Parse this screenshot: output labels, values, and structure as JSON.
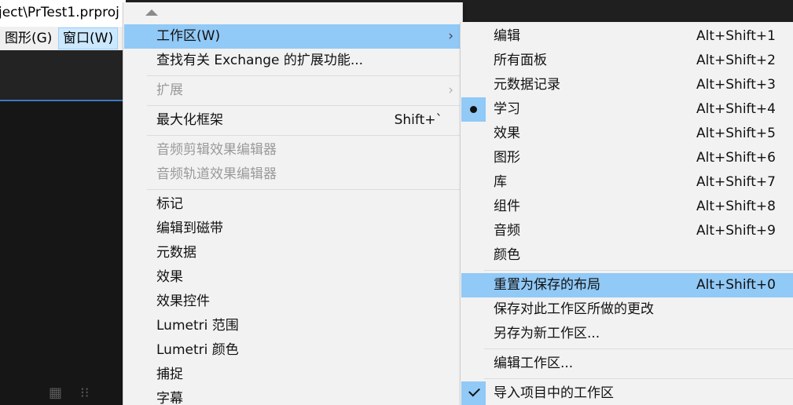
{
  "app": {
    "title_fragment": "ject\\PrTest1.prproj",
    "menubar": {
      "graphics": "图形(G)",
      "window": "窗口(W)"
    },
    "panel_icons": [
      "film-icon",
      "audio-waveform-icon"
    ]
  },
  "main_menu": {
    "scroll_up": "scroll-up-arrow-icon",
    "items": [
      {
        "label": "工作区(W)",
        "has_submenu": true,
        "state": "highlighted"
      },
      {
        "label": "查找有关 Exchange 的扩展功能..."
      },
      {
        "label": "扩展",
        "has_submenu": true,
        "state": "disabled"
      },
      {
        "label": "最大化框架",
        "shortcut": "Shift+`"
      },
      {
        "label": "音频剪辑效果编辑器",
        "state": "disabled"
      },
      {
        "label": "音频轨道效果编辑器",
        "state": "disabled"
      },
      {
        "label": "标记"
      },
      {
        "label": "编辑到磁带"
      },
      {
        "label": "元数据"
      },
      {
        "label": "效果"
      },
      {
        "label": "效果控件"
      },
      {
        "label": "Lumetri 范围"
      },
      {
        "label": "Lumetri 颜色"
      },
      {
        "label": "捕捉"
      },
      {
        "label": "字幕"
      }
    ]
  },
  "workspace_submenu": {
    "items": [
      {
        "label": "编辑",
        "shortcut": "Alt+Shift+1"
      },
      {
        "label": "所有面板",
        "shortcut": "Alt+Shift+2"
      },
      {
        "label": "元数据记录",
        "shortcut": "Alt+Shift+3"
      },
      {
        "label": "学习",
        "shortcut": "Alt+Shift+4",
        "selected": true
      },
      {
        "label": "效果",
        "shortcut": "Alt+Shift+5"
      },
      {
        "label": "图形",
        "shortcut": "Alt+Shift+6"
      },
      {
        "label": "库",
        "shortcut": "Alt+Shift+7"
      },
      {
        "label": "组件",
        "shortcut": "Alt+Shift+8"
      },
      {
        "label": "音频",
        "shortcut": "Alt+Shift+9"
      },
      {
        "label": "颜色"
      },
      {
        "label": "重置为保存的布局",
        "shortcut": "Alt+Shift+0",
        "state": "highlighted"
      },
      {
        "label": "保存对此工作区所做的更改"
      },
      {
        "label": "另存为新工作区..."
      },
      {
        "label": "编辑工作区..."
      },
      {
        "label": "导入项目中的工作区",
        "checked": true
      }
    ]
  },
  "colors": {
    "highlight": "#91c9f7",
    "menu_background": "#f2f2f2",
    "disabled_text": "#9a9a9a",
    "app_background": "#1f1f1f"
  }
}
